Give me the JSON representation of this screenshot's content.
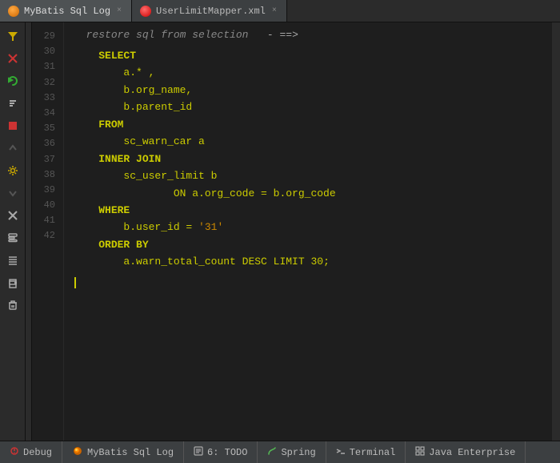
{
  "tabs": [
    {
      "label": "UserLimitMapper.xml",
      "icon": "file-icon",
      "active": false,
      "closeable": true
    }
  ],
  "window_title": "MyBatis Sql Log",
  "comment_line": {
    "line_number": "29",
    "text": "restore sql from selection",
    "arrow": "- ==>"
  },
  "sql": {
    "select": "SELECT",
    "col1": "a.* ,",
    "col2": "b.org_name,",
    "col3": "b.parent_id",
    "from": "FROM",
    "table1": "sc_warn_car a",
    "inner_join": "INNER JOIN",
    "table2": "sc_user_limit b",
    "on_clause": "ON a.org_code = b.org_code",
    "where": "WHERE",
    "where_condition": "b.user_id = '31'",
    "order_by": "ORDER BY",
    "order_col": "a.warn_total_count DESC  LIMIT 30;"
  },
  "toolbar": {
    "buttons": [
      {
        "name": "filter",
        "icon": "▼",
        "label": "filter"
      },
      {
        "name": "clear-red",
        "icon": "✕",
        "label": "clear"
      },
      {
        "name": "refresh",
        "icon": "↺",
        "label": "refresh"
      },
      {
        "name": "sort",
        "icon": "⇅",
        "label": "sort"
      },
      {
        "name": "stop",
        "icon": "■",
        "label": "stop"
      },
      {
        "name": "up",
        "icon": "↑",
        "label": "up"
      },
      {
        "name": "wrench",
        "icon": "🔧",
        "label": "wrench"
      },
      {
        "name": "down",
        "icon": "↓",
        "label": "down"
      },
      {
        "name": "close",
        "icon": "✕",
        "label": "close"
      },
      {
        "name": "format",
        "icon": "≡",
        "label": "format"
      },
      {
        "name": "format2",
        "icon": "≣",
        "label": "format2"
      },
      {
        "name": "print",
        "icon": "⎙",
        "label": "print"
      },
      {
        "name": "delete",
        "icon": "🗑",
        "label": "delete"
      }
    ]
  },
  "status_bar": {
    "items": [
      {
        "name": "debug",
        "icon": "bug",
        "label": "Debug"
      },
      {
        "name": "mybatis",
        "icon": "flame",
        "label": "MyBatis Sql Log"
      },
      {
        "name": "todo",
        "icon": "list",
        "label": "6: TODO"
      },
      {
        "name": "spring",
        "icon": "leaf",
        "label": "Spring"
      },
      {
        "name": "terminal",
        "icon": "arrow",
        "label": "Terminal"
      },
      {
        "name": "java-enterprise",
        "icon": "grid",
        "label": "Java Enterprise"
      }
    ]
  },
  "colors": {
    "bg": "#1e1e1e",
    "toolbar_bg": "#2b2b2b",
    "tab_active": "#4e5254",
    "keyword": "#cccc00",
    "status_bar": "#3c3f41"
  }
}
